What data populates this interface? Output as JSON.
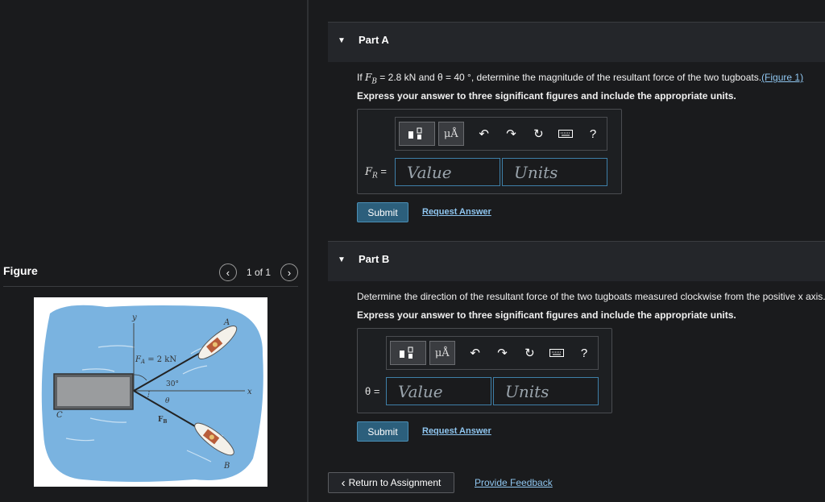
{
  "figure_panel": {
    "title": "Figure",
    "counter": "1 of 1",
    "prev_icon": "chevron-left-icon",
    "next_icon": "chevron-right-icon",
    "labels": {
      "y": "y",
      "x": "x",
      "A": "A",
      "B": "B",
      "C": "C",
      "FA": "F",
      "FA_sub": "A",
      "FA_value": " = 2 kN",
      "FB": "F",
      "FB_sub": "B",
      "angle30": "30°",
      "theta": "θ"
    }
  },
  "partA": {
    "title": "Part A",
    "question_pre": "If ",
    "question_var": "F",
    "question_var_sub": "B",
    "question_mid": " = 2.8 kN and θ = 40 °, determine the magnitude of the resultant force of the two tugboats.",
    "figure_link": "(Figure 1)",
    "instruction": "Express your answer to three significant figures and include the appropriate units.",
    "field_label_var": "F",
    "field_label_sub": "R",
    "field_label_eq": " =",
    "value_placeholder": "Value",
    "units_placeholder": "Units",
    "submit_label": "Submit",
    "request_label": "Request Answer"
  },
  "partB": {
    "title": "Part B",
    "question": "Determine the direction of the resultant force of the two tugboats measured clockwise from the positive x axis.",
    "instruction": "Express your answer to three significant figures and include the appropriate units.",
    "field_label": "θ =",
    "value_placeholder": "Value",
    "units_placeholder": "Units",
    "submit_label": "Submit",
    "request_label": "Request Answer"
  },
  "toolbar": {
    "units_symbol": "μÅ",
    "help": "?"
  },
  "footer": {
    "return_label": "Return to Assignment",
    "feedback_label": "Provide Feedback"
  },
  "colors": {
    "accent": "#2c5f7c",
    "link": "#8fc6f0",
    "water": "#7ab3e0"
  }
}
